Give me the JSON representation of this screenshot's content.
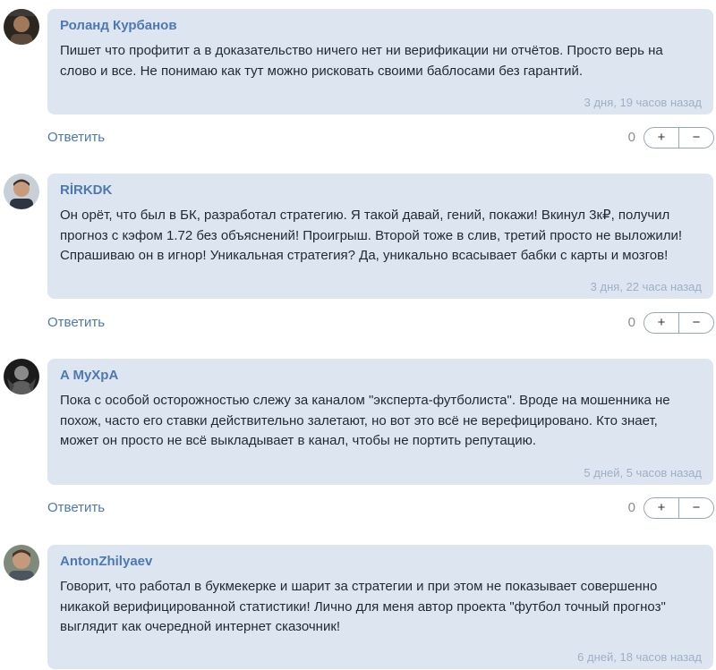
{
  "comments": [
    {
      "author": "Роланд Курбанов",
      "text": "Пишет что профитит а в доказательство ничего нет ни верификации ни отчётов. Просто верь на\nслово и все. Не понимаю как тут можно рисковать своими баблосами без гарантий.",
      "time": "3 дня, 19 часов назад",
      "reply_label": "Ответить",
      "score": "0",
      "plus": "+",
      "minus": "−"
    },
    {
      "author": "RİRKDK",
      "text": "Он орёт, что был в БК, разработал стратегию. Я такой давай, гений, покажи! Вкинул 3к₽, получил\nпрогноз с кэфом 1.72 без объяснений! Проигрыш. Второй тоже в слив, третий просто не выложили!\nСпрашиваю он в игнор! Уникальная стратегия? Да, уникально всасывает бабки с карты и мозгов!",
      "time": "3 дня, 22 часа назад",
      "reply_label": "Ответить",
      "score": "0",
      "plus": "+",
      "minus": "−"
    },
    {
      "author": "A MyXpA",
      "text": "Пока с особой осторожностью слежу за каналом \"эксперта-футболиста\". Вроде на мошенника не\nпохож, часто его ставки действительно залетают, но вот это всё не верефицировано. Кто знает,\nможет он просто не всё выкладывает в канал, чтобы не портить репутацию.",
      "time": "5 дней, 5 часов назад",
      "reply_label": "Ответить",
      "score": "0",
      "plus": "+",
      "minus": "−"
    },
    {
      "author": "AntonZhilyaev",
      "text": "Говорит, что работал в букмекерке и шарит за стратегии и при этом не показывает совершенно\nникакой верифицированной статистики! Лично для меня автор проекта \"футбол точный прогноз\"\nвыглядит как очередной интернет сказочник!",
      "time": "6 дней, 18 часов назад"
    }
  ]
}
